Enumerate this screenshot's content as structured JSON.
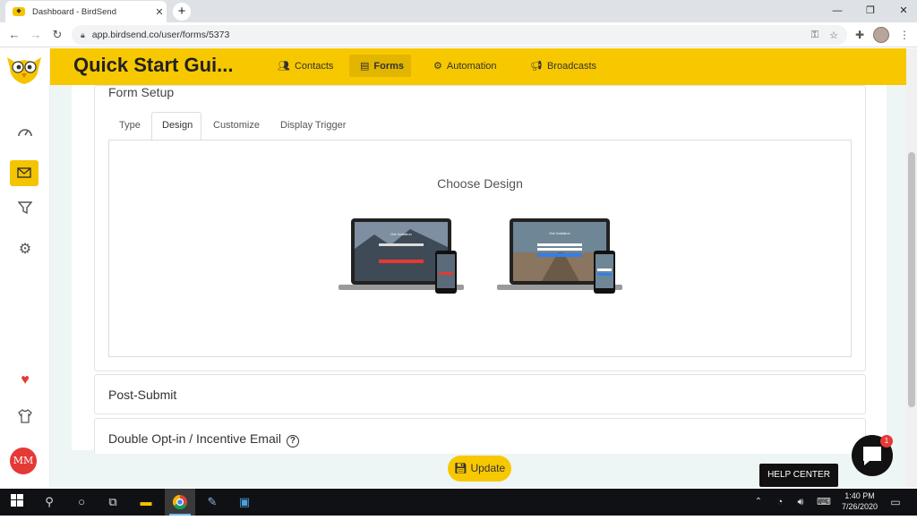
{
  "browser": {
    "tab_title": "Dashboard - BirdSend",
    "tab_close": "✕",
    "new_tab": "+",
    "url": "app.birdsend.co/user/forms/5373",
    "win_min": "—",
    "win_max": "❐",
    "win_close": "✕"
  },
  "app": {
    "title": "Quick Start Gui...",
    "nav": [
      {
        "label": "Contacts",
        "icon": "contacts-icon"
      },
      {
        "label": "Forms",
        "icon": "forms-icon"
      },
      {
        "label": "Automation",
        "icon": "automation-icon"
      },
      {
        "label": "Broadcasts",
        "icon": "broadcast-icon"
      }
    ],
    "avatar_initials": "MM"
  },
  "form_setup": {
    "title": "Form Setup",
    "tabs": [
      "Type",
      "Design",
      "Customize",
      "Display Trigger"
    ],
    "active_tab": "Design",
    "choose_design": "Choose Design",
    "preview_heading": "Get Invitation"
  },
  "sections": {
    "post_submit": "Post-Submit",
    "double_optin": "Double Opt-in / Incentive Email",
    "help_glyph": "?"
  },
  "footer": {
    "update_label": "Update",
    "help_center": "HELP CENTER",
    "chat_badge": "1"
  },
  "taskbar": {
    "time": "1:40 PM",
    "date": "7/26/2020"
  },
  "colors": {
    "brand_yellow": "#f7c800",
    "forms_active": "#e2b500",
    "heart": "#e53935"
  }
}
